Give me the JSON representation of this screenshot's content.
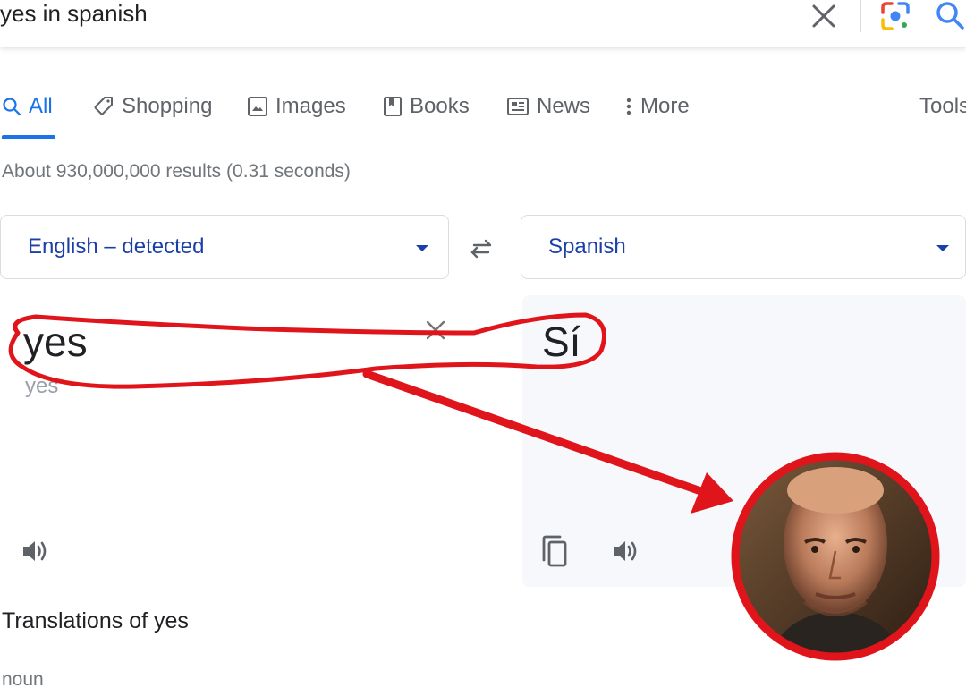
{
  "search": {
    "query": "yes in spanish",
    "clear_icon": "close-icon",
    "lens_icon": "google-lens-icon",
    "search_icon": "search-icon"
  },
  "tabs": [
    {
      "label": "All",
      "icon": "search-icon",
      "active": true
    },
    {
      "label": "Shopping",
      "icon": "tag-icon"
    },
    {
      "label": "Images",
      "icon": "image-icon"
    },
    {
      "label": "Books",
      "icon": "book-icon"
    },
    {
      "label": "News",
      "icon": "news-icon"
    },
    {
      "label": "More",
      "icon": "more-vert-icon"
    }
  ],
  "tools_label": "Tools",
  "result_stats": "About 930,000,000 results (0.31 seconds)",
  "translator": {
    "source_lang": "English – detected",
    "target_lang": "Spanish",
    "source_text": "yes",
    "source_transliteration": "yes",
    "target_text": "Sí"
  },
  "translations_heading": "Translations of yes",
  "part_of_speech": "noun",
  "colors": {
    "accent": "#1a73e8",
    "language_text": "#1a3fa8",
    "annotation_red": "#e0141b",
    "target_pane_bg": "#f6f8fb"
  }
}
